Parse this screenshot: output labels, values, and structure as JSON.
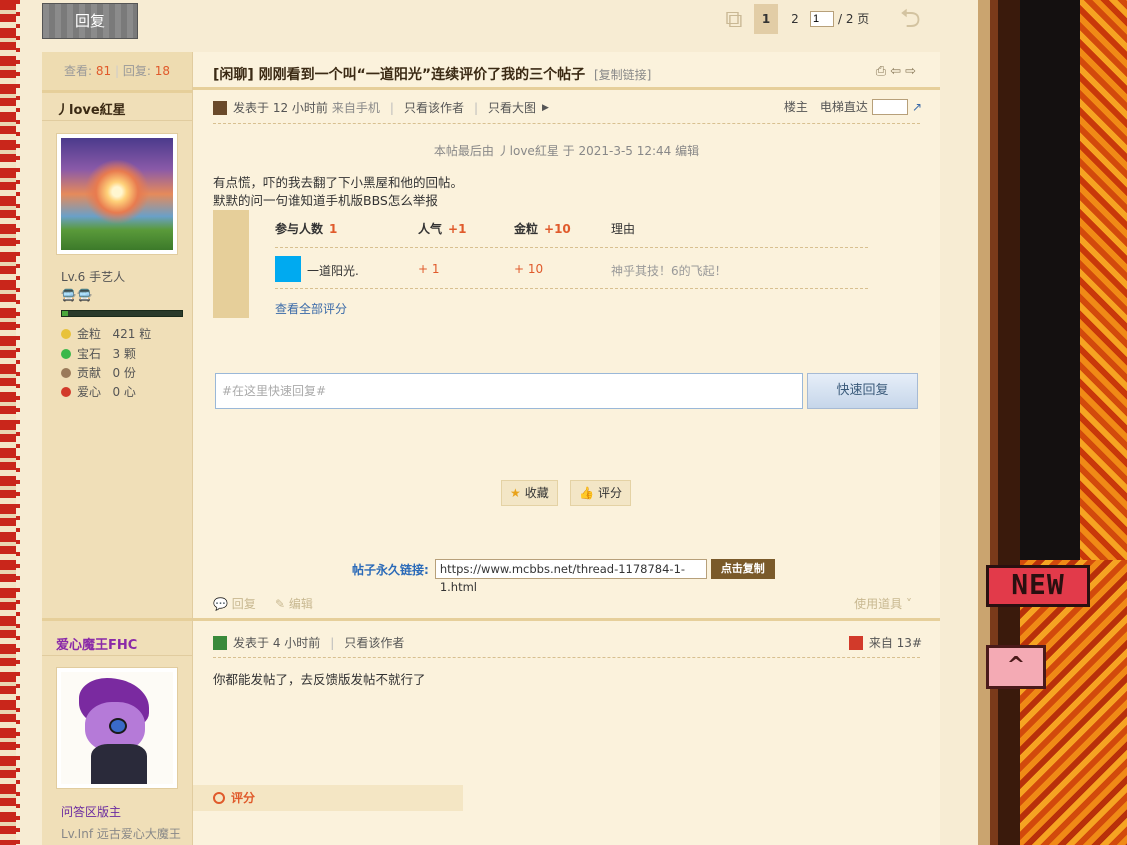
{
  "top": {
    "reply_button": "回复",
    "pager": {
      "current": "1",
      "next": "2",
      "input_value": "1",
      "total": "/ 2 页"
    }
  },
  "thread": {
    "stats_views_label": "查看:",
    "stats_views": "81",
    "stats_replies_label": "回复:",
    "stats_replies": "18",
    "title": "[闲聊] 刚刚看到一个叫“一道阳光”连续评价了我的三个帖子",
    "copy_link": "[复制链接]"
  },
  "post1": {
    "author": "丿love紅星",
    "level": "Lv.6 手艺人",
    "badges": "🚍🚍",
    "exp_fraction": 0.05,
    "stats": [
      {
        "label": "金粒",
        "value": "421 粒",
        "color": "#e8c23a"
      },
      {
        "label": "宝石",
        "value": "3 颗",
        "color": "#3ab84a"
      },
      {
        "label": "贡献",
        "value": "0 份",
        "color": "#9a7a5a"
      },
      {
        "label": "爱心",
        "value": "0 心",
        "color": "#d23a2a"
      }
    ],
    "meta": {
      "posted": "发表于 12 小时前",
      "source": "来自手机",
      "only_author": "只看该作者",
      "big_image": "只看大图"
    },
    "floor": {
      "label": "楼主",
      "goto": "电梯直达"
    },
    "edit_note": "本帖最后由 丿love紅星 于 2021-3-5 12:44 编辑",
    "body_line1": "有点慌，吓的我去翻了下小黑屋和他的回帖。",
    "body_line2": "默默的问一句谁知道手机版BBS怎么举报",
    "rating": {
      "h_people": "参与人数",
      "h_people_val": "1",
      "h_pop": "人气",
      "h_pop_val": "+1",
      "h_gold": "金粒",
      "h_gold_val": "+10",
      "h_reason": "理由",
      "user": "一道阳光.",
      "pop": "+ 1",
      "gold": "+ 10",
      "reason": "神乎其技！6的飞起！",
      "view_all": "查看全部评分"
    },
    "quick_reply_placeholder": "#在这里快速回复#",
    "quick_reply_button": "快速回复",
    "favorite": "收藏",
    "rate": "评分",
    "permalink_label": "帖子永久链接:",
    "permalink_url": "https://www.mcbbs.net/thread-1178784-1-1.html",
    "copy_button": "点击复制",
    "foot_reply": "回复",
    "foot_edit": "编辑",
    "use_tool": "使用道具"
  },
  "post2": {
    "author": "爱心魔王FHC",
    "meta": {
      "posted": "发表于 4 小时前",
      "only_author": "只看该作者"
    },
    "floor": "来自 13#",
    "body": "你都能发帖了，去反馈版发帖不就行了",
    "rate": "评分",
    "title": "问答区版主",
    "level": "Lv.Inf 远古爱心大魔王"
  },
  "side_deco": {
    "new_badge": "NEW"
  },
  "colors": {
    "accent": "#e05a2b",
    "link": "#3a6aa8",
    "bg": "#f7ecd3"
  }
}
